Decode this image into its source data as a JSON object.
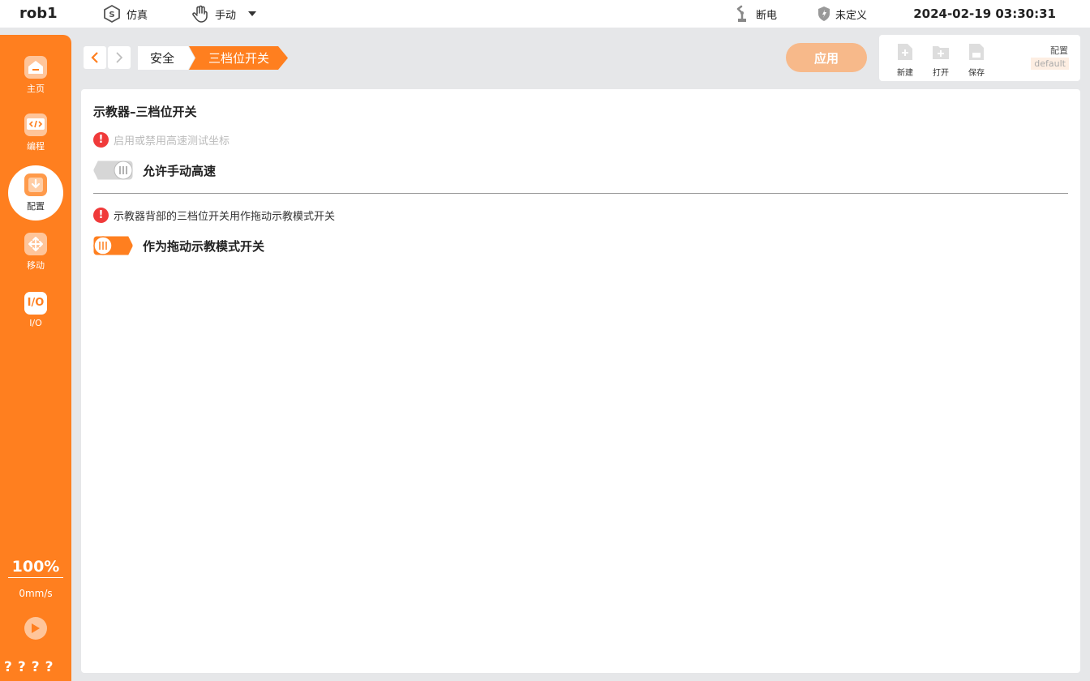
{
  "topbar": {
    "robot_name": "rob1",
    "mode_sim": "仿真",
    "mode_manual": "手动",
    "power_status": "断电",
    "safety_status": "未定义",
    "datetime": "2024-02-19 03:30:31"
  },
  "sidebar": {
    "items": [
      {
        "label": "主页",
        "icon": "home-icon"
      },
      {
        "label": "编程",
        "icon": "code-icon"
      },
      {
        "label": "配置",
        "icon": "config-icon",
        "active": true
      },
      {
        "label": "移动",
        "icon": "move-icon"
      },
      {
        "label": "I/O",
        "icon": "io-icon",
        "glyph": "I/O"
      }
    ],
    "speed": "100%",
    "velocity": "0mm/s",
    "status_marks": "????"
  },
  "breadcrumb": {
    "items": [
      "安全",
      "三档位开关"
    ]
  },
  "toolbar": {
    "apply_label": "应用",
    "new_label": "新建",
    "open_label": "打开",
    "save_label": "保存",
    "config_label": "配置",
    "config_name": "default"
  },
  "main": {
    "title": "示教器–三档位开关",
    "settings": [
      {
        "hint": "启用或禁用高速测试坐标",
        "hint_disabled": true,
        "label": "允许手动高速",
        "enabled": false
      },
      {
        "hint": "示教器背部的三档位开关用作拖动示教模式开关",
        "hint_disabled": false,
        "label": "作为拖动示教模式开关",
        "enabled": true
      }
    ]
  },
  "colors": {
    "accent": "#ff7f1f",
    "warning": "#f03a3a",
    "apply_button": "#f7b98a"
  }
}
